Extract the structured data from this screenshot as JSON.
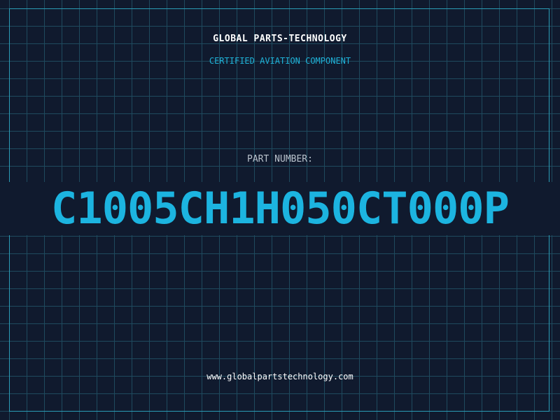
{
  "header": {
    "company_name": "GLOBAL PARTS-TECHNOLOGY",
    "subtitle": "CERTIFIED AVIATION COMPONENT"
  },
  "part": {
    "label": "PART NUMBER:",
    "number": "C1005CH1H050CT000P"
  },
  "footer": {
    "website": "www.globalpartstechnology.com"
  },
  "colors": {
    "background": "#101a2e",
    "grid": "#1e4a5e",
    "accent": "#1cb4e0",
    "text_primary": "#ffffff",
    "text_muted": "#b9c2cc"
  }
}
